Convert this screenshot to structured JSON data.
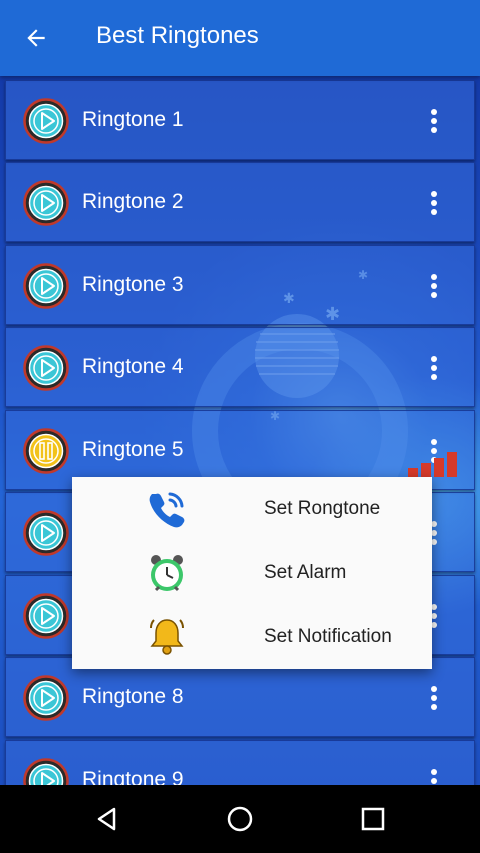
{
  "app_bar": {
    "title": "Best Ringtones",
    "back_icon": "arrow-left-icon",
    "color": "#1f6ad6"
  },
  "ringtones": [
    {
      "label": "Ringtone 1",
      "state": "play"
    },
    {
      "label": "Ringtone 2",
      "state": "play"
    },
    {
      "label": "Ringtone 3",
      "state": "play"
    },
    {
      "label": "Ringtone 4",
      "state": "play"
    },
    {
      "label": "Ringtone 5",
      "state": "pause"
    },
    {
      "label": "",
      "state": "play"
    },
    {
      "label": "",
      "state": "play"
    },
    {
      "label": "Ringtone 8",
      "state": "play"
    },
    {
      "label": "Ringtone 9",
      "state": "play"
    }
  ],
  "popup_menu": {
    "items": [
      {
        "label": "Set Rongtone",
        "icon": "phone-call-icon"
      },
      {
        "label": "Set Alarm",
        "icon": "alarm-clock-icon"
      },
      {
        "label": "Set Notification",
        "icon": "bell-icon"
      }
    ]
  },
  "nav_bar": {
    "back_icon": "nav-back-icon",
    "home_icon": "nav-home-icon",
    "recents_icon": "nav-recents-icon"
  },
  "colors": {
    "play_ring": "#c0392b",
    "play_fill": "#3bc6d6",
    "pause_fill": "#f2c21a",
    "signal": "#d63a2a"
  }
}
